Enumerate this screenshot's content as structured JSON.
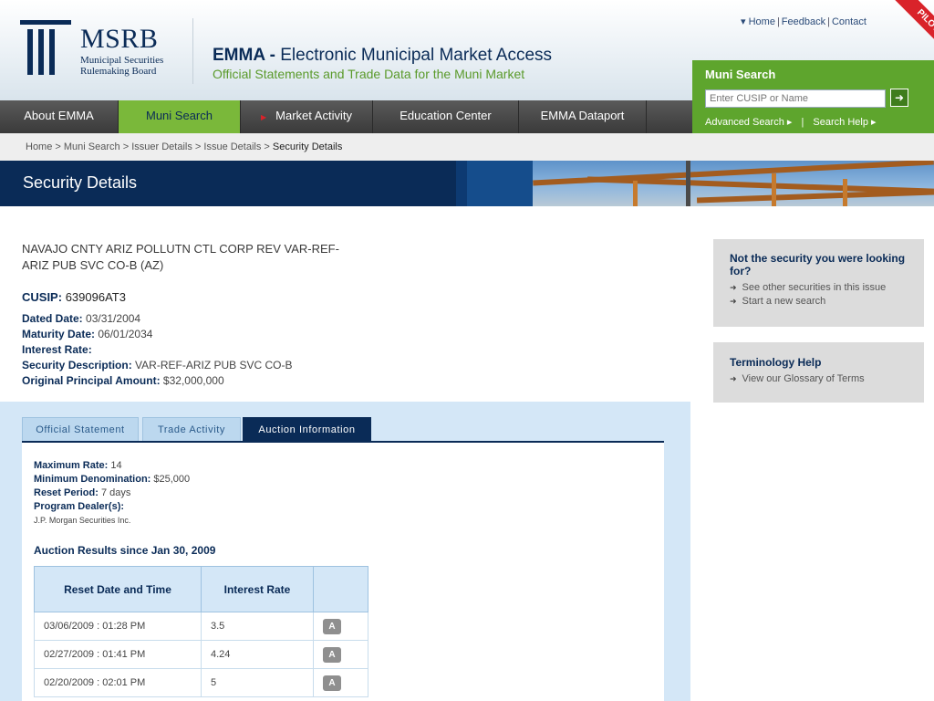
{
  "header": {
    "org_name": "MSRB",
    "org_sub_line1": "Municipal Securities",
    "org_sub_line2": "Rulemaking Board",
    "emma_bold": "EMMA -",
    "emma_title": " Electronic Municipal Market Access",
    "emma_subtitle": "Official Statements and Trade Data for the Muni Market",
    "top_links": [
      "Home",
      "Feedback",
      "Contact"
    ],
    "pilot": "PILOT"
  },
  "muni_search": {
    "title": "Muni Search",
    "placeholder": "Enter CUSIP or Name",
    "go": "➜",
    "advanced": "Advanced Search ▸",
    "sep": "|",
    "help": "Search Help ▸"
  },
  "nav": [
    "About EMMA",
    "Muni Search",
    "Market Activity",
    "Education Center",
    "EMMA Dataport"
  ],
  "breadcrumb": [
    "Home",
    "Muni Search",
    "Issuer Details",
    "Issue Details",
    "Security Details"
  ],
  "banner_title": "Security Details",
  "security": {
    "name": "NAVAJO CNTY ARIZ POLLUTN CTL CORP REV VAR-REF-ARIZ PUB SVC CO-B (AZ)",
    "cusip_label": "CUSIP:",
    "cusip": "639096AT3",
    "dated_label": "Dated Date:",
    "dated": "03/31/2004",
    "maturity_label": "Maturity Date:",
    "maturity": "06/01/2034",
    "rate_label": "Interest Rate:",
    "rate": "",
    "desc_label": "Security Description:",
    "desc": "VAR-REF-ARIZ PUB SVC CO-B",
    "principal_label": "Original Principal Amount:",
    "principal": "$32,000,000"
  },
  "tabs": [
    "Official Statement",
    "Trade Activity",
    "Auction Information"
  ],
  "auction": {
    "max_rate_label": "Maximum Rate:",
    "max_rate": "14",
    "min_denom_label": "Minimum Denomination:",
    "min_denom": "$25,000",
    "reset_label": "Reset Period:",
    "reset": "7 days",
    "dealer_label": "Program Dealer(s):",
    "dealer": "J.P. Morgan Securities Inc.",
    "results_title": "Auction Results since Jan 30, 2009",
    "columns": [
      "Reset Date and Time",
      "Interest Rate",
      ""
    ],
    "rows": [
      {
        "date": "03/06/2009 : 01:28 PM",
        "rate": "3.5",
        "badge": "A"
      },
      {
        "date": "02/27/2009 : 01:41 PM",
        "rate": "4.24",
        "badge": "A"
      },
      {
        "date": "02/20/2009 : 02:01 PM",
        "rate": "5",
        "badge": "A"
      }
    ]
  },
  "sidebar": {
    "box1_title": "Not the security you were looking for?",
    "box1_links": [
      "See other securities in this issue",
      "Start a new search"
    ],
    "box2_title": "Terminology Help",
    "box2_links": [
      "View our Glossary of Terms"
    ]
  }
}
